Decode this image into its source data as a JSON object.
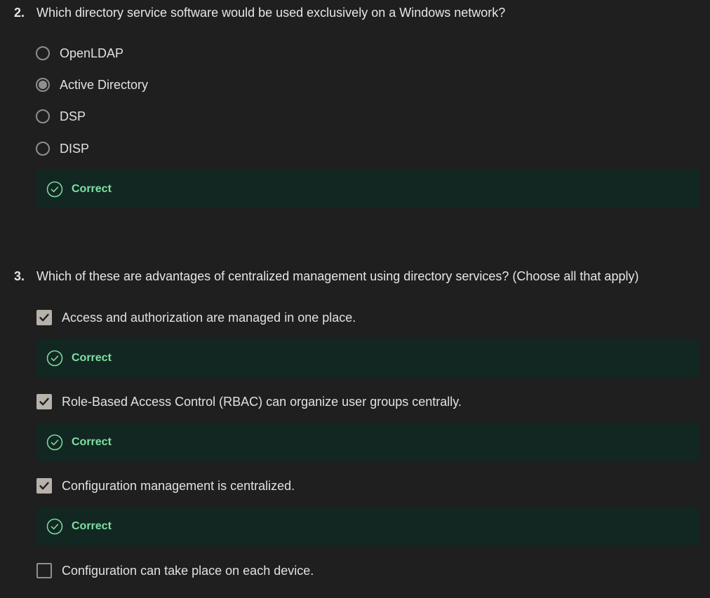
{
  "questions": [
    {
      "number": "2.",
      "text": "Which directory service software would be used exclusively on a Windows network?",
      "options": [
        {
          "label": "OpenLDAP",
          "selected": false
        },
        {
          "label": "Active Directory",
          "selected": true
        },
        {
          "label": "DSP",
          "selected": false
        },
        {
          "label": "DISP",
          "selected": false
        }
      ],
      "feedback": "Correct"
    },
    {
      "number": "3.",
      "text": "Which of these are advantages of centralized management using directory services? (Choose all that apply)",
      "options": [
        {
          "label": "Access and authorization are managed in one place.",
          "checked": true,
          "feedback": "Correct"
        },
        {
          "label": "Role-Based Access Control (RBAC) can organize user groups centrally.",
          "checked": true,
          "feedback": "Correct"
        },
        {
          "label": "Configuration management is centralized.",
          "checked": true,
          "feedback": "Correct"
        },
        {
          "label": "Configuration can take place on each device.",
          "checked": false
        }
      ]
    }
  ],
  "colors": {
    "background": "#1f1f1f",
    "feedback_background": "#132722",
    "correct_text": "#7ee0a4",
    "control_border": "#8f8f8f",
    "checkbox_fill": "#b7b2aa"
  },
  "icons": {
    "correct": "check-circle-icon",
    "checkmark": "checkmark-icon"
  }
}
